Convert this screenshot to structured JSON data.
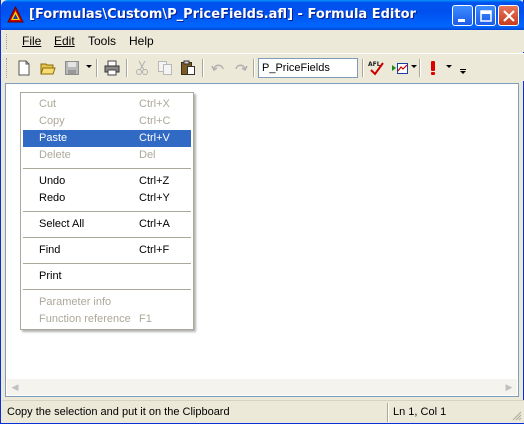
{
  "window": {
    "title": "[Formulas\\Custom\\P_PriceFields.afl] - Formula Editor",
    "app_icon": "amibroker-triangle-icon"
  },
  "menubar": {
    "items": [
      {
        "label": "File",
        "accel": "F"
      },
      {
        "label": "Edit",
        "accel": "E"
      },
      {
        "label": "Tools",
        "accel": "T"
      },
      {
        "label": "Help",
        "accel": "H"
      }
    ]
  },
  "toolbar": {
    "formula_name": "P_PriceFields",
    "icons": [
      "new-icon",
      "open-icon",
      "save-icon",
      "print-icon",
      "cut-icon",
      "copy-icon",
      "paste-icon",
      "undo-icon",
      "redo-icon",
      "afl-check-icon",
      "apply-indicator-icon",
      "error-icon"
    ]
  },
  "context_menu": {
    "items": [
      {
        "label": "Cut",
        "shortcut": "Ctrl+X",
        "enabled": false
      },
      {
        "label": "Copy",
        "shortcut": "Ctrl+C",
        "enabled": false
      },
      {
        "label": "Paste",
        "shortcut": "Ctrl+V",
        "enabled": true,
        "selected": true
      },
      {
        "label": "Delete",
        "shortcut": "Del",
        "enabled": false
      },
      {
        "label": "Undo",
        "shortcut": "Ctrl+Z",
        "enabled": true
      },
      {
        "label": "Redo",
        "shortcut": "Ctrl+Y",
        "enabled": true
      },
      {
        "label": "Select All",
        "shortcut": "Ctrl+A",
        "enabled": true
      },
      {
        "label": "Find",
        "shortcut": "Ctrl+F",
        "enabled": true
      },
      {
        "label": "Print",
        "shortcut": "",
        "enabled": true
      },
      {
        "label": "Parameter info",
        "shortcut": "",
        "enabled": false
      },
      {
        "label": "Function reference",
        "shortcut": "F1",
        "enabled": false
      }
    ]
  },
  "statusbar": {
    "message": "Copy the selection and put it on the Clipboard",
    "position": "Ln 1, Col 1"
  },
  "colors": {
    "titlebar": "#0055ea",
    "selection": "#316ac5",
    "disabled_text": "#aca899",
    "chrome": "#ece9d8"
  }
}
